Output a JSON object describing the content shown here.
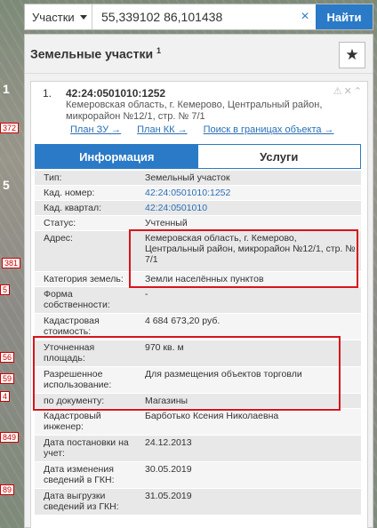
{
  "map": {
    "tags": [
      "372",
      "381",
      "56",
      "59",
      "4",
      "5",
      "849",
      "89"
    ],
    "side_numbers": [
      "1",
      "5"
    ]
  },
  "search": {
    "type_label": "Участки",
    "value": "55,339102 86,101438",
    "clear": "×",
    "button": "Найти"
  },
  "panel": {
    "title": "Земельные участки",
    "title_sup": "1",
    "star": "★"
  },
  "card": {
    "number": "1.",
    "cad_number": "42:24:0501010:1252",
    "address": "Кемеровская область, г. Кемерово, Центральный район, микрорайон №12/1, стр. № 7/1",
    "icons": "⚠✕⌃",
    "links": [
      "План ЗУ →",
      "План КК →",
      "Поиск в границах объекта →"
    ]
  },
  "tabs": {
    "info": "Информация",
    "services": "Услуги"
  },
  "rows": [
    {
      "label": "Тип:",
      "value": "Земельный участок"
    },
    {
      "label": "Кад. номер:",
      "value": "42:24:0501010:1252"
    },
    {
      "label": "Кад. квартал:",
      "value": "42:24:0501010"
    },
    {
      "label": "Статус:",
      "value": "Учтенный"
    },
    {
      "label": "Адрес:",
      "value": "Кемеровская область, г. Кемерово, Центральный район, микрорайон №12/1, стр. № 7/1"
    },
    {
      "label": "Категория земель:",
      "value": "Земли населённых пунктов"
    },
    {
      "label": "Форма собственности:",
      "value": "-"
    },
    {
      "label": "Кадастровая стоимость:",
      "value": "4 684 673,20 руб."
    },
    {
      "label": "Уточненная площадь:",
      "value": "970 кв. м"
    },
    {
      "label": "Разрешенное использование:",
      "value": "Для размещения объектов торговли"
    },
    {
      "label": "по документу:",
      "value": "Магазины"
    },
    {
      "label": "Кадастровый инженер:",
      "value": "Барботько Ксения Николаевна"
    },
    {
      "label": "Дата постановки на учет:",
      "value": "24.12.2013"
    },
    {
      "label": "Дата изменения сведений в ГКН:",
      "value": "30.05.2019"
    },
    {
      "label": "Дата выгрузки сведений из ГКН:",
      "value": "31.05.2019"
    }
  ]
}
